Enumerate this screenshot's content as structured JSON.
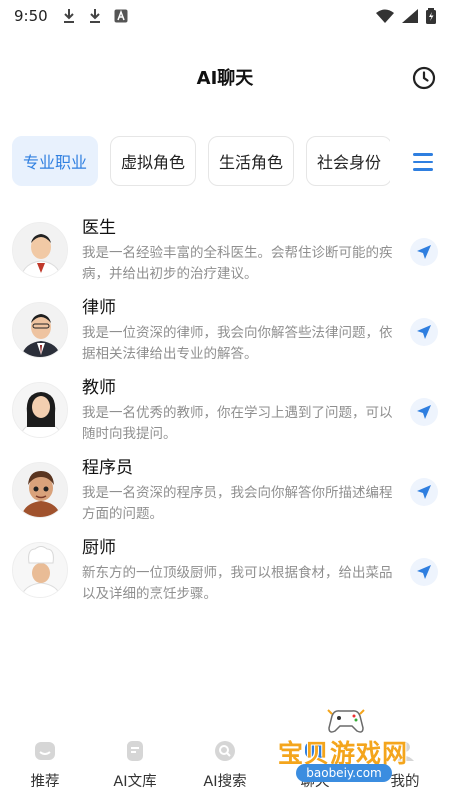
{
  "status_bar": {
    "time": "9:50"
  },
  "header": {
    "title": "AI聊天"
  },
  "tabs": [
    {
      "label": "专业职业",
      "active": true
    },
    {
      "label": "虚拟角色",
      "active": false
    },
    {
      "label": "生活角色",
      "active": false
    },
    {
      "label": "社会身份",
      "active": false
    }
  ],
  "roles": [
    {
      "name": "医生",
      "desc": "我是一名经验丰富的全科医生。会帮住诊断可能的疾病，并给出初步的治疗建议。"
    },
    {
      "name": "律师",
      "desc": "我是一位资深的律师，我会向你解答些法律问题，依据相关法律给出专业的解答。"
    },
    {
      "name": "教师",
      "desc": "我是一名优秀的教师，你在学习上遇到了问题，可以随时向我提问。"
    },
    {
      "name": "程序员",
      "desc": "我是一名资深的程序员，我会向你解答你所描述编程方面的问题。"
    },
    {
      "name": "厨师",
      "desc": "新东方的一位顶级厨师，我可以根据食材，给出菜品以及详细的烹饪步骤。"
    }
  ],
  "bottom_nav": [
    {
      "label": "推荐"
    },
    {
      "label": "AI文库"
    },
    {
      "label": "AI搜索"
    },
    {
      "label": "聊天"
    },
    {
      "label": "我的"
    }
  ],
  "watermark": {
    "title": "宝贝游戏网",
    "url": "baobeiy.com"
  },
  "colors": {
    "accent": "#2f7fe0",
    "tab_active_bg": "#e8f1fd",
    "desc_text": "#8f8f8f"
  }
}
